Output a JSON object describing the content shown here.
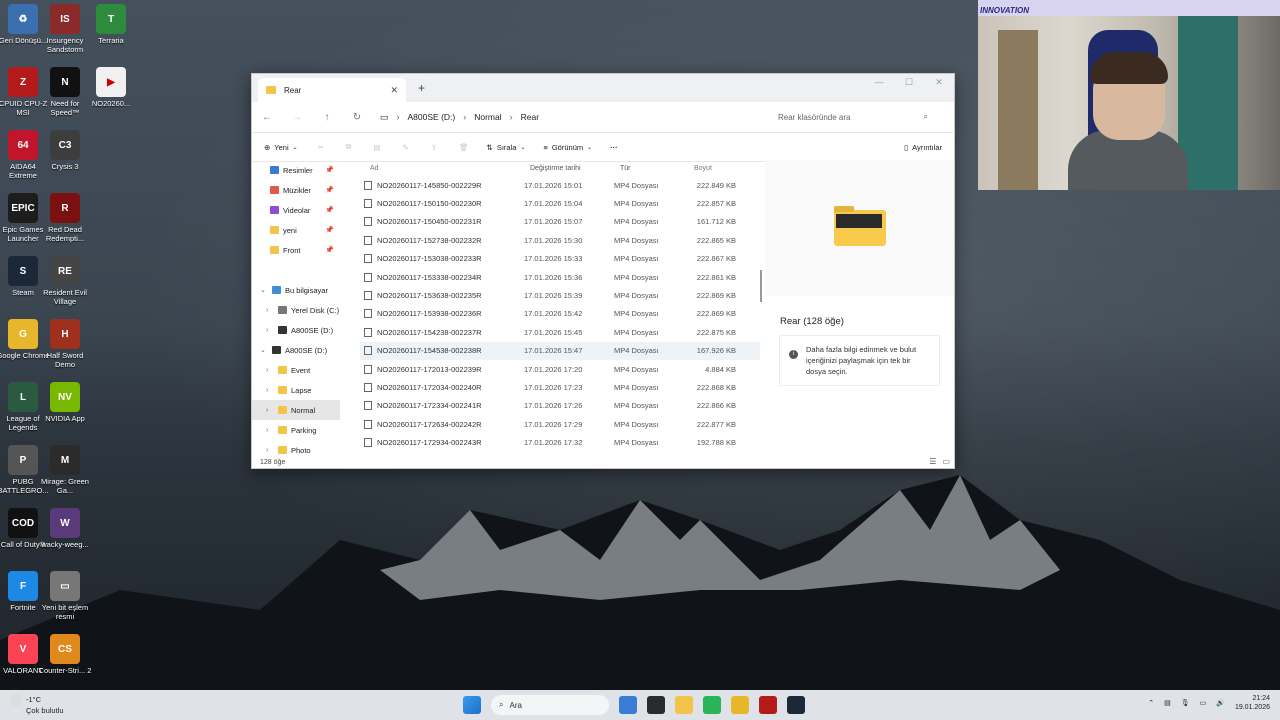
{
  "desktop_icons": [
    {
      "label": "Geri Dönüşü...",
      "color": "#3b6fb0",
      "glyph": "♻"
    },
    {
      "label": "Insurgency Sandstorm",
      "color": "#8a2a2a",
      "glyph": "IS"
    },
    {
      "label": "Terraria",
      "color": "#2e8b3e",
      "glyph": "T"
    },
    {
      "label": "CPUID CPU-Z MSI",
      "color": "#b51a1a",
      "glyph": "Z"
    },
    {
      "label": "Need for Speed™",
      "color": "#111111",
      "glyph": "N"
    },
    {
      "label": "NO20260...",
      "color": "#f0f0f0",
      "glyph": "▶"
    },
    {
      "label": "AIDA64 Extreme",
      "color": "#c0152b",
      "glyph": "64"
    },
    {
      "label": "Crysis 3",
      "color": "#3d3d3d",
      "glyph": "C3"
    },
    {
      "label": "Epic Games Launcher",
      "color": "#1d1d1d",
      "glyph": "EPIC"
    },
    {
      "label": "Red Dead Redempti...",
      "color": "#7a1010",
      "glyph": "R"
    },
    {
      "label": "Steam",
      "color": "#1b2838",
      "glyph": "S"
    },
    {
      "label": "Resident Evil Village",
      "color": "#444444",
      "glyph": "RE"
    },
    {
      "label": "Google Chrome",
      "color": "#e8b62a",
      "glyph": "G"
    },
    {
      "label": "Half Sword Demo",
      "color": "#a0301e",
      "glyph": "H"
    },
    {
      "label": "League of Legends",
      "color": "#2a5a40",
      "glyph": "L"
    },
    {
      "label": "NVIDIA App",
      "color": "#76b900",
      "glyph": "NV"
    },
    {
      "label": "PUBG BATTLEGRO...",
      "color": "#555555",
      "glyph": "P"
    },
    {
      "label": "Mirage: Green Ga...",
      "color": "#2b2b2b",
      "glyph": "M"
    },
    {
      "label": "Call of Duty®",
      "color": "#111111",
      "glyph": "COD"
    },
    {
      "label": "wacky-weeg...",
      "color": "#5a3a7a",
      "glyph": "W"
    },
    {
      "label": "Fortnite",
      "color": "#1e88e5",
      "glyph": "F"
    },
    {
      "label": "Yeni bit eşlem resmi",
      "color": "#777777",
      "glyph": "▭"
    },
    {
      "label": "VALORANT",
      "color": "#fa4454",
      "glyph": "V"
    },
    {
      "label": "Counter-Stri... 2",
      "color": "#e08a1e",
      "glyph": "CS"
    }
  ],
  "explorer": {
    "tab_title": "Rear",
    "new_tab": "+",
    "window_controls": [
      "—",
      "☐",
      "✕"
    ],
    "breadcrumb": [
      "A800SE (D:)",
      "Normal",
      "Rear"
    ],
    "search_placeholder": "Rear klasöründe ara",
    "toolbar": {
      "new": "Yeni",
      "sort": "Sırala",
      "view": "Görünüm",
      "more": "···",
      "details": "Ayrıntılar"
    },
    "sidebar": [
      {
        "label": "Resimler",
        "color": "#3a7bd5",
        "pinned": true,
        "indent": 18
      },
      {
        "label": "Müzikler",
        "color": "#e0584a",
        "pinned": true,
        "indent": 18
      },
      {
        "label": "Videolar",
        "color": "#8a4fd0",
        "pinned": true,
        "indent": 18
      },
      {
        "label": "yeni",
        "color": "#f3c44a",
        "pinned": true,
        "indent": 18
      },
      {
        "label": "Front",
        "color": "#f3c44a",
        "pinned": true,
        "indent": 18
      },
      {
        "label": "",
        "color": "",
        "pinned": false,
        "indent": 18
      },
      {
        "label": "Bu bilgisayar",
        "color": "#3a8fd5",
        "pinned": false,
        "indent": 20,
        "arrow": "⌄"
      },
      {
        "label": "Yerel Disk (C:)",
        "color": "#777777",
        "pinned": false,
        "indent": 26,
        "arrow": "›"
      },
      {
        "label": "A800SE (D:)",
        "color": "#333333",
        "pinned": false,
        "indent": 26,
        "arrow": "›"
      },
      {
        "label": "A800SE (D:)",
        "color": "#333333",
        "pinned": false,
        "indent": 20,
        "arrow": "⌄"
      },
      {
        "label": "Event",
        "color": "#f3c44a",
        "pinned": false,
        "indent": 26,
        "arrow": "›"
      },
      {
        "label": "Lapse",
        "color": "#f3c44a",
        "pinned": false,
        "indent": 26,
        "arrow": "›"
      },
      {
        "label": "Normal",
        "color": "#f3c44a",
        "pinned": false,
        "indent": 26,
        "arrow": "›",
        "selected": true
      },
      {
        "label": "Parking",
        "color": "#f3c44a",
        "pinned": false,
        "indent": 26,
        "arrow": "›"
      },
      {
        "label": "Photo",
        "color": "#f3c44a",
        "pinned": false,
        "indent": 26,
        "arrow": "›"
      }
    ],
    "columns": {
      "name": "Ad",
      "date": "Değiştirme tarihi",
      "type": "Tür",
      "size": "Boyut"
    },
    "files": [
      {
        "name": "NO20260117-145850-002229R",
        "date": "17.01.2026 15:01",
        "type": "MP4 Dosyası",
        "size": "222.849 KB"
      },
      {
        "name": "NO20260117-150150-002230R",
        "date": "17.01.2026 15:04",
        "type": "MP4 Dosyası",
        "size": "222.857 KB"
      },
      {
        "name": "NO20260117-150450-002231R",
        "date": "17.01.2026 15:07",
        "type": "MP4 Dosyası",
        "size": "161.712 KB"
      },
      {
        "name": "NO20260117-152738-002232R",
        "date": "17.01.2026 15:30",
        "type": "MP4 Dosyası",
        "size": "222.865 KB"
      },
      {
        "name": "NO20260117-153038-002233R",
        "date": "17.01.2026 15:33",
        "type": "MP4 Dosyası",
        "size": "222.867 KB"
      },
      {
        "name": "NO20260117-153338-002234R",
        "date": "17.01.2026 15:36",
        "type": "MP4 Dosyası",
        "size": "222.861 KB"
      },
      {
        "name": "NO20260117-153638-002235R",
        "date": "17.01.2026 15:39",
        "type": "MP4 Dosyası",
        "size": "222.869 KB"
      },
      {
        "name": "NO20260117-153938-002236R",
        "date": "17.01.2026 15:42",
        "type": "MP4 Dosyası",
        "size": "222.869 KB"
      },
      {
        "name": "NO20260117-154238-002237R",
        "date": "17.01.2026 15:45",
        "type": "MP4 Dosyası",
        "size": "222.875 KB"
      },
      {
        "name": "NO20260117-154538-002238R",
        "date": "17.01.2026 15:47",
        "type": "MP4 Dosyası",
        "size": "167.926 KB",
        "selected": true
      },
      {
        "name": "NO20260117-172013-002239R",
        "date": "17.01.2026 17:20",
        "type": "MP4 Dosyası",
        "size": "4.884 KB"
      },
      {
        "name": "NO20260117-172034-002240R",
        "date": "17.01.2026 17:23",
        "type": "MP4 Dosyası",
        "size": "222.868 KB"
      },
      {
        "name": "NO20260117-172334-002241R",
        "date": "17.01.2026 17:26",
        "type": "MP4 Dosyası",
        "size": "222.866 KB"
      },
      {
        "name": "NO20260117-172634-002242R",
        "date": "17.01.2026 17:29",
        "type": "MP4 Dosyası",
        "size": "222.877 KB"
      },
      {
        "name": "NO20260117-172934-002243R",
        "date": "17.01.2026 17:32",
        "type": "MP4 Dosyası",
        "size": "192.788 KB"
      }
    ],
    "detail_title": "Rear (128 öğe)",
    "detail_info": "Daha fazla bilgi edinmek ve bulut içeriğinizi paylaşmak için tek bir dosya seçin.",
    "status": "128 öğe"
  },
  "webcam": {
    "banner": "INNOVATION"
  },
  "taskbar": {
    "weather_temp": "-1°C",
    "weather_desc": "Çok bulutlu",
    "search_label": "Ara",
    "apps": [
      "#3a7bd5",
      "#2b2b2b",
      "#f3c44a",
      "#2ab45a",
      "#e8b62a",
      "#b51a1a",
      "#1b2838"
    ],
    "time": "21:24",
    "date": "19.01.2026"
  }
}
